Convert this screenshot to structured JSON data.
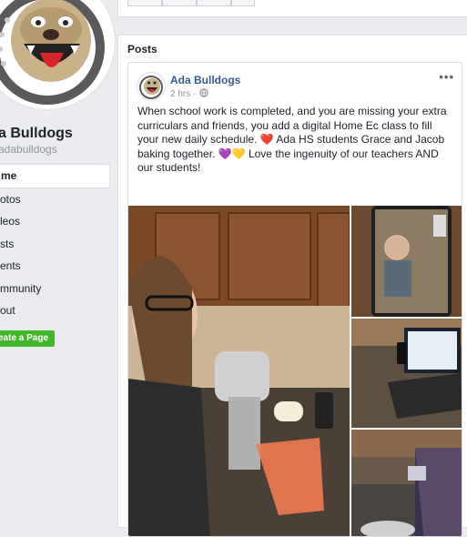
{
  "sidebar": {
    "page_name": "a Bulldogs",
    "handle": "adabulldogs",
    "nav": [
      {
        "label": "me",
        "active": true
      },
      {
        "label": "otos",
        "active": false
      },
      {
        "label": "leos",
        "active": false
      },
      {
        "label": "sts",
        "active": false
      },
      {
        "label": "ents",
        "active": false
      },
      {
        "label": "mmunity",
        "active": false
      },
      {
        "label": "out",
        "active": false
      }
    ],
    "create_page": "eate a Page"
  },
  "posts": {
    "heading": "Posts",
    "post": {
      "author": "Ada Bulldogs",
      "time": "2 hrs",
      "privacy_icon": "globe-icon",
      "menu": "•••",
      "text_part1": "When school work is completed, and you are missing your extra curriculars and friends, you add a digital Home Ec class to fill your new daily schedule. ",
      "heart": "❤️",
      "text_part2": " Ada HS students Grace and Jacob baking together. ",
      "hearts": "💜💛",
      "text_part3": " Love the ingenuity of our teachers AND our students!"
    }
  },
  "colors": {
    "link": "#385898",
    "create_button": "#42b72a",
    "background": "#e9ebee"
  }
}
